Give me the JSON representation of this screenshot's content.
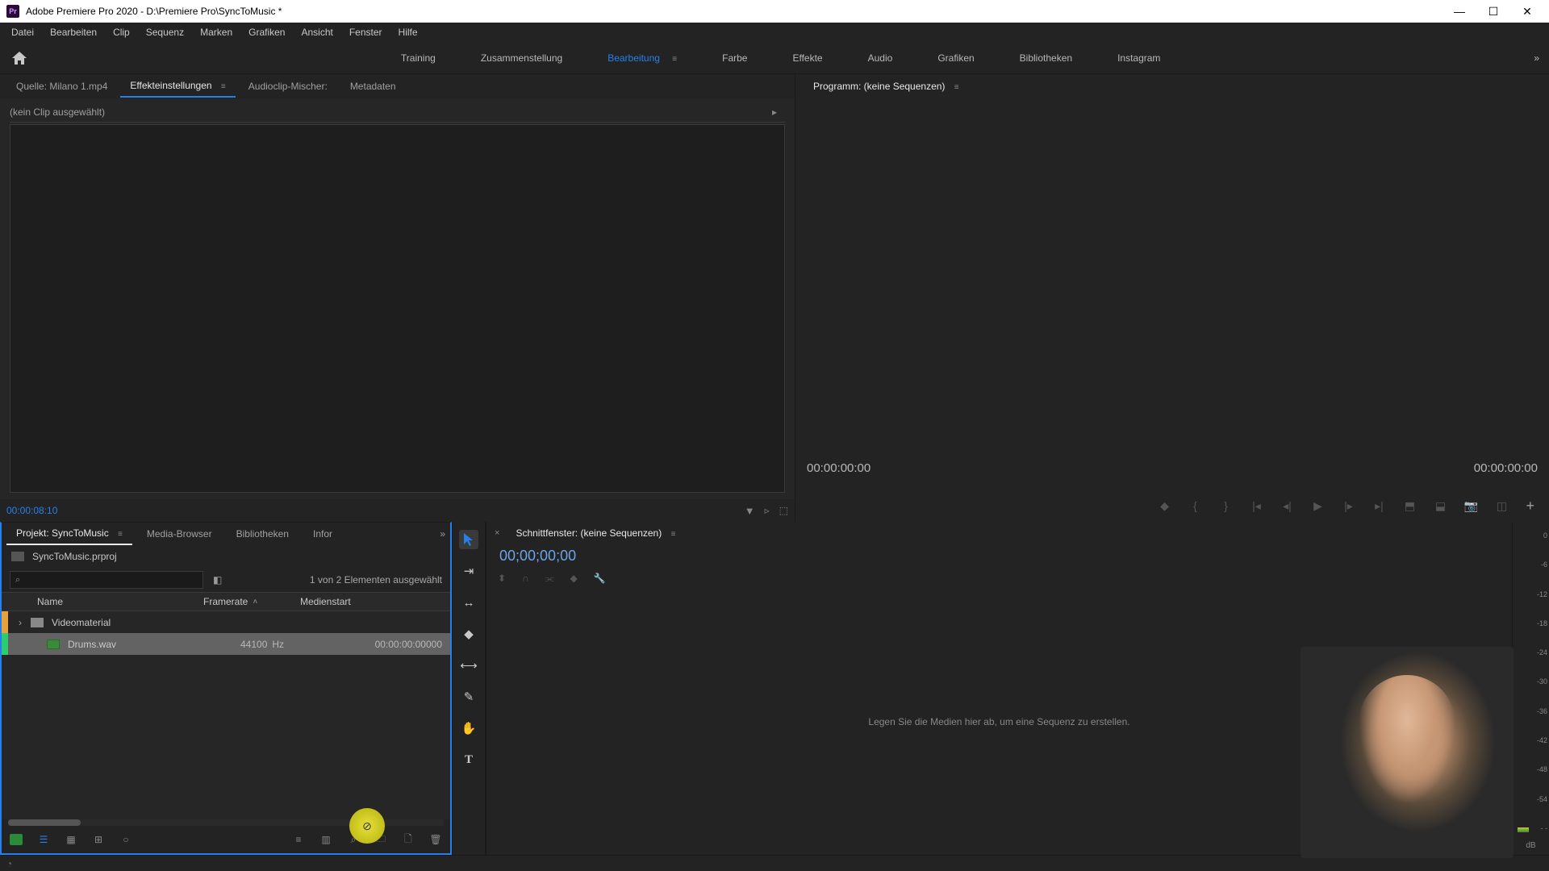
{
  "titlebar": {
    "app_short": "Pr",
    "title": "Adobe Premiere Pro 2020 - D:\\Premiere Pro\\SyncToMusic *"
  },
  "menu": {
    "items": [
      "Datei",
      "Bearbeiten",
      "Clip",
      "Sequenz",
      "Marken",
      "Grafiken",
      "Ansicht",
      "Fenster",
      "Hilfe"
    ]
  },
  "workspaces": {
    "items": [
      "Training",
      "Zusammenstellung",
      "Bearbeitung",
      "Farbe",
      "Effekte",
      "Audio",
      "Grafiken",
      "Bibliotheken",
      "Instagram"
    ],
    "active_index": 2,
    "more_glyph": "»"
  },
  "source_panel": {
    "tabs": [
      {
        "label": "Quelle: Milano 1.mp4",
        "active": false
      },
      {
        "label": "Effekteinstellungen",
        "active": true,
        "burger": "≡"
      },
      {
        "label": "Audioclip-Mischer:",
        "active": false
      },
      {
        "label": "Metadaten",
        "active": false
      }
    ],
    "no_clip_text": "(kein Clip ausgewählt)",
    "expand_glyph": "▸",
    "footer_timecode": "00:00:08:10",
    "filter_glyph": "▼"
  },
  "program_panel": {
    "tab_label": "Programm: (keine Sequenzen)",
    "burger": "≡",
    "timecode_left": "00:00:00:00",
    "timecode_right": "00:00:00:00",
    "add_glyph": "+"
  },
  "project_panel": {
    "tabs": [
      {
        "label": "Projekt: SyncToMusic",
        "active": true,
        "burger": "≡"
      },
      {
        "label": "Media-Browser",
        "active": false
      },
      {
        "label": "Bibliotheken",
        "active": false
      },
      {
        "label": "Infor",
        "active": false
      }
    ],
    "more_glyph": "»",
    "project_file": "SyncToMusic.prproj",
    "search_placeholder": "",
    "selection_text": "1 von 2 Elementen ausgewählt",
    "columns": {
      "name": "Name",
      "framerate": "Framerate",
      "medienstart": "Medienstart",
      "sort_glyph": "˄"
    },
    "rows": [
      {
        "chip": "#e6a23c",
        "twirl": "›",
        "icon": "folder",
        "name": "Videomaterial",
        "framerate": "",
        "unit": "",
        "medienstart": "",
        "selected": false
      },
      {
        "chip": "#2ecc71",
        "twirl": "",
        "icon": "audio",
        "name": "Drums.wav",
        "framerate": "44100",
        "unit": "Hz",
        "medienstart": "00:00:00:00000",
        "selected": true
      }
    ]
  },
  "tools": {
    "items": [
      {
        "name": "selection-tool",
        "glyph": "▸",
        "active": true,
        "fill": "#2680eb"
      },
      {
        "name": "track-select-tool",
        "glyph": "⇥"
      },
      {
        "name": "ripple-edit-tool",
        "glyph": "↔"
      },
      {
        "name": "razor-tool",
        "glyph": "◆"
      },
      {
        "name": "slip-tool",
        "glyph": "⟷"
      },
      {
        "name": "pen-tool",
        "glyph": "✎"
      },
      {
        "name": "hand-tool",
        "glyph": "✋"
      },
      {
        "name": "type-tool",
        "glyph": "T"
      }
    ]
  },
  "timeline_panel": {
    "close_glyph": "×",
    "tab_label": "Schnittfenster: (keine Sequenzen)",
    "burger": "≡",
    "timecode": "00;00;00;00",
    "dropzone_text": "Legen Sie die Medien hier ab, um eine Sequenz zu erstellen.",
    "wrench_glyph": "🔧"
  },
  "audio_meters": {
    "ticks": [
      "0",
      "-6",
      "-12",
      "-18",
      "-24",
      "-30",
      "-36",
      "-42",
      "-48",
      "-54",
      "- -"
    ],
    "unit_label": "dB"
  },
  "colors": {
    "accent": "#2680eb",
    "panel_bg": "#232323",
    "highlight": "#e6e038"
  }
}
